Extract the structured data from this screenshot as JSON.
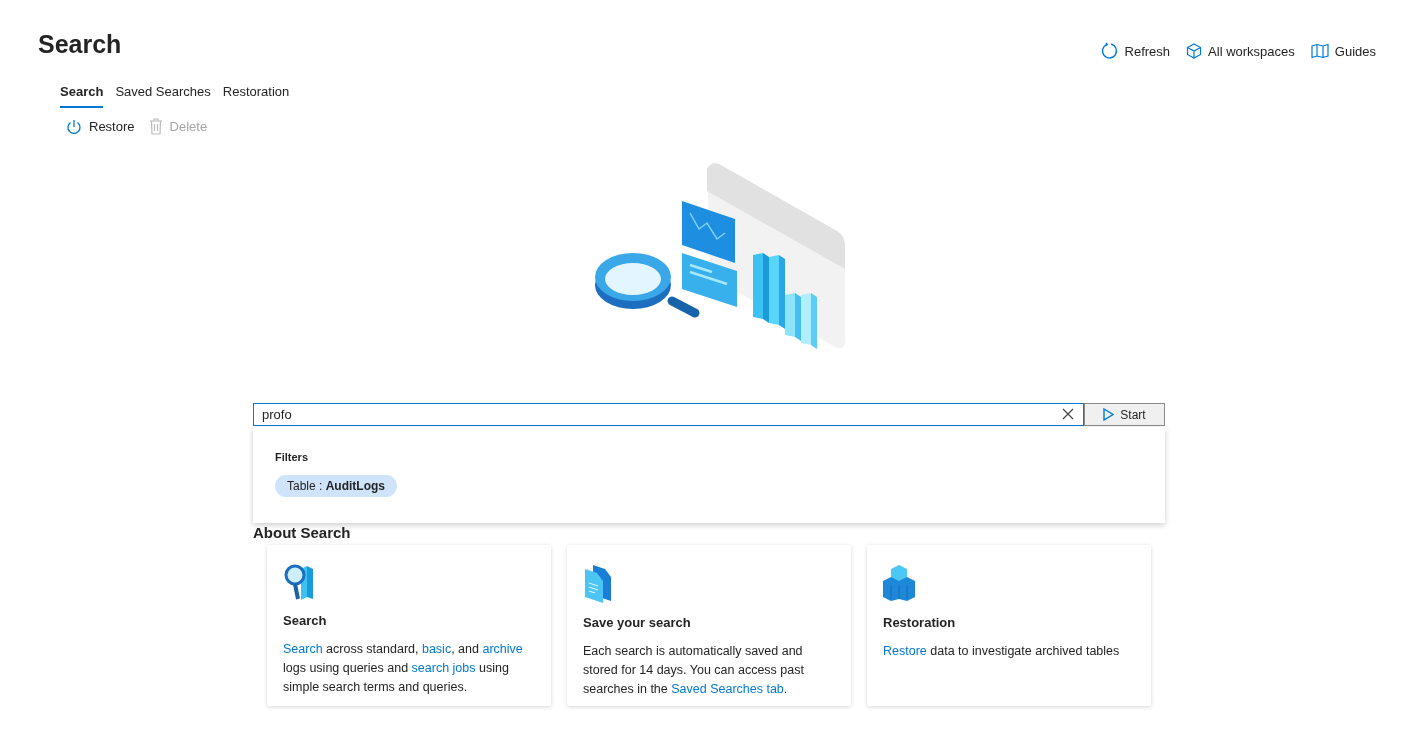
{
  "page": {
    "title": "Search"
  },
  "header_actions": [
    {
      "kind": "refresh",
      "label": "Refresh"
    },
    {
      "kind": "workspaces",
      "label": "All workspaces"
    },
    {
      "kind": "guides",
      "label": "Guides"
    }
  ],
  "tabs": [
    {
      "label": "Search",
      "selected": true
    },
    {
      "label": "Saved Searches",
      "selected": false
    },
    {
      "label": "Restoration",
      "selected": false
    }
  ],
  "toolbar": [
    {
      "kind": "restore",
      "label": "Restore",
      "disabled": false
    },
    {
      "kind": "delete",
      "label": "Delete",
      "disabled": true
    }
  ],
  "search": {
    "value": "profo",
    "button": "Start"
  },
  "dropdown": {
    "heading": "Filters",
    "chips": [
      {
        "label": "Table : **AuditLogs**"
      }
    ]
  },
  "about": {
    "heading": "About Search"
  },
  "cards": [
    {
      "kind": "search",
      "title": "Search",
      "body": [
        {
          "text": "Search",
          "link": true
        },
        {
          "text": " across standard, ",
          "link": false
        },
        {
          "text": "basic",
          "link": true
        },
        {
          "text": ", and ",
          "link": false
        },
        {
          "text": "archive",
          "link": true
        },
        {
          "text": " logs using queries and ",
          "link": false
        },
        {
          "text": "search jobs",
          "link": true
        },
        {
          "text": " using simple search terms and queries.",
          "link": false
        }
      ]
    },
    {
      "kind": "save",
      "title": "Save your search",
      "body": [
        {
          "text": "Each search is automatically saved and stored for 14 days. You can access past searches in the ",
          "link": false
        },
        {
          "text": "Saved Searches tab",
          "link": true
        },
        {
          "text": ".",
          "link": false
        }
      ]
    },
    {
      "kind": "restore",
      "title": "Restoration",
      "body": [
        {
          "text": "Restore",
          "link": true
        },
        {
          "text": " data to investigate archived tables",
          "link": false
        }
      ]
    }
  ]
}
